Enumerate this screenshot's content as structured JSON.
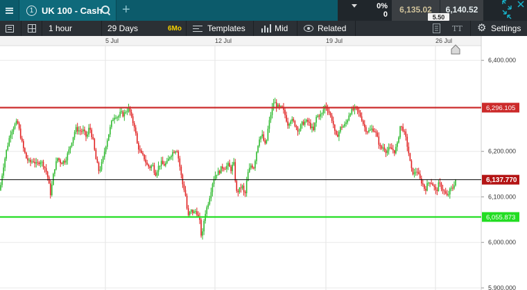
{
  "window": {
    "tab_number": "1",
    "instrument": "UK 100 - Cash"
  },
  "quote": {
    "change_pct": "0%",
    "change_points": "0",
    "sell_price": "6,135.02",
    "buy_price": "6,140.52",
    "spread": "5.50"
  },
  "toolbar": {
    "interval": "1 hour",
    "range": "29 Days",
    "range_badge": "6Mo",
    "templates_label": "Templates",
    "price_type_label": "Mid",
    "related_label": "Related",
    "settings_label": "Settings"
  },
  "icons": [
    "hamburger-menu-icon",
    "search-icon",
    "add-tab-icon",
    "change-arrow-icon",
    "expand-icon",
    "close-icon",
    "minimize-icon",
    "drawing-list-icon",
    "layout-grid-icon",
    "templates-icon",
    "mid-price-icon",
    "related-eye-icon",
    "document-icon",
    "text-size-icon",
    "gear-icon",
    "price-marker-icon"
  ],
  "colors": {
    "header_bg": "#0c5b6b",
    "toolbar_bg": "#2b3035",
    "up_candle": "#2db92d",
    "down_candle": "#e02020",
    "resistance": "#cc2a2a",
    "support": "#22dd22",
    "current_price": "#b41414"
  },
  "chart_data": {
    "type": "candlestick",
    "x_tick_labels": [
      "5 Jul",
      "12 Jul",
      "19 Jul",
      "26 Jul"
    ],
    "y_tick_labels": [
      "6,400.000",
      "6,200.000",
      "6,100.000",
      "6,000.000",
      "5,900.000"
    ],
    "ylim": [
      5900,
      6400
    ],
    "horizontal_lines": [
      {
        "label": "6,296.105",
        "value": 6296.105,
        "color": "#cc2a2a"
      },
      {
        "label": "6,137.770",
        "value": 6137.77,
        "color": "#000000",
        "current": true
      },
      {
        "label": "6,055.873",
        "value": 6055.873,
        "color": "#22dd22"
      }
    ],
    "path": [
      [
        0,
        6115
      ],
      [
        4,
        6160
      ],
      [
        9,
        6200
      ],
      [
        15,
        6240
      ],
      [
        20,
        6255
      ],
      [
        25,
        6265
      ],
      [
        28,
        6245
      ],
      [
        33,
        6210
      ],
      [
        38,
        6185
      ],
      [
        43,
        6175
      ],
      [
        48,
        6180
      ],
      [
        53,
        6170
      ],
      [
        58,
        6180
      ],
      [
        63,
        6170
      ],
      [
        68,
        6150
      ],
      [
        73,
        6105
      ],
      [
        78,
        6160
      ],
      [
        83,
        6185
      ],
      [
        88,
        6175
      ],
      [
        94,
        6180
      ],
      [
        99,
        6200
      ],
      [
        104,
        6225
      ],
      [
        109,
        6250
      ],
      [
        115,
        6245
      ],
      [
        120,
        6245
      ],
      [
        125,
        6230
      ],
      [
        129,
        6255
      ],
      [
        134,
        6225
      ],
      [
        138,
        6185
      ],
      [
        143,
        6155
      ],
      [
        148,
        6180
      ],
      [
        152,
        6210
      ],
      [
        157,
        6240
      ],
      [
        162,
        6270
      ],
      [
        166,
        6280
      ],
      [
        170,
        6275
      ],
      [
        174,
        6285
      ],
      [
        178,
        6280
      ],
      [
        182,
        6290
      ],
      [
        186,
        6295
      ],
      [
        190,
        6270
      ],
      [
        194,
        6255
      ],
      [
        198,
        6215
      ],
      [
        203,
        6195
      ],
      [
        208,
        6185
      ],
      [
        212,
        6170
      ],
      [
        216,
        6165
      ],
      [
        220,
        6170
      ],
      [
        224,
        6150
      ],
      [
        228,
        6165
      ],
      [
        232,
        6175
      ],
      [
        236,
        6170
      ],
      [
        241,
        6175
      ],
      [
        245,
        6190
      ],
      [
        250,
        6200
      ],
      [
        255,
        6205
      ],
      [
        259,
        6170
      ],
      [
        263,
        6130
      ],
      [
        267,
        6110
      ],
      [
        271,
        6055
      ],
      [
        275,
        6070
      ],
      [
        279,
        6065
      ],
      [
        283,
        6070
      ],
      [
        288,
        6045
      ],
      [
        291,
        6005
      ],
      [
        295,
        6060
      ],
      [
        299,
        6080
      ],
      [
        303,
        6105
      ],
      [
        307,
        6135
      ],
      [
        311,
        6150
      ],
      [
        316,
        6155
      ],
      [
        320,
        6165
      ],
      [
        325,
        6165
      ],
      [
        329,
        6170
      ],
      [
        333,
        6160
      ],
      [
        337,
        6175
      ],
      [
        341,
        6110
      ],
      [
        345,
        6115
      ],
      [
        349,
        6125
      ],
      [
        353,
        6100
      ],
      [
        357,
        6150
      ],
      [
        362,
        6170
      ],
      [
        366,
        6165
      ],
      [
        370,
        6200
      ],
      [
        374,
        6230
      ],
      [
        378,
        6235
      ],
      [
        383,
        6210
      ],
      [
        387,
        6255
      ],
      [
        391,
        6285
      ],
      [
        395,
        6310
      ],
      [
        399,
        6300
      ],
      [
        403,
        6295
      ],
      [
        407,
        6295
      ],
      [
        411,
        6280
      ],
      [
        415,
        6260
      ],
      [
        419,
        6270
      ],
      [
        423,
        6265
      ],
      [
        427,
        6255
      ],
      [
        431,
        6245
      ],
      [
        435,
        6260
      ],
      [
        440,
        6265
      ],
      [
        444,
        6265
      ],
      [
        448,
        6255
      ],
      [
        452,
        6245
      ],
      [
        456,
        6275
      ],
      [
        460,
        6280
      ],
      [
        464,
        6280
      ],
      [
        468,
        6300
      ],
      [
        472,
        6295
      ],
      [
        476,
        6280
      ],
      [
        480,
        6265
      ],
      [
        484,
        6230
      ],
      [
        488,
        6240
      ],
      [
        492,
        6255
      ],
      [
        496,
        6255
      ],
      [
        500,
        6265
      ],
      [
        504,
        6285
      ],
      [
        508,
        6290
      ],
      [
        513,
        6295
      ],
      [
        517,
        6285
      ],
      [
        521,
        6275
      ],
      [
        525,
        6255
      ],
      [
        529,
        6245
      ],
      [
        533,
        6245
      ],
      [
        537,
        6250
      ],
      [
        541,
        6245
      ],
      [
        545,
        6225
      ],
      [
        549,
        6205
      ],
      [
        553,
        6210
      ],
      [
        557,
        6200
      ],
      [
        561,
        6205
      ],
      [
        565,
        6205
      ],
      [
        569,
        6200
      ],
      [
        573,
        6215
      ],
      [
        577,
        6255
      ],
      [
        581,
        6250
      ],
      [
        585,
        6230
      ],
      [
        589,
        6200
      ],
      [
        593,
        6160
      ],
      [
        597,
        6150
      ],
      [
        601,
        6160
      ],
      [
        605,
        6140
      ],
      [
        609,
        6130
      ],
      [
        613,
        6115
      ],
      [
        617,
        6130
      ],
      [
        621,
        6135
      ],
      [
        625,
        6125
      ],
      [
        629,
        6110
      ],
      [
        633,
        6130
      ],
      [
        637,
        6120
      ],
      [
        641,
        6110
      ],
      [
        645,
        6100
      ],
      [
        649,
        6115
      ],
      [
        653,
        6120
      ],
      [
        657,
        6138
      ]
    ]
  }
}
